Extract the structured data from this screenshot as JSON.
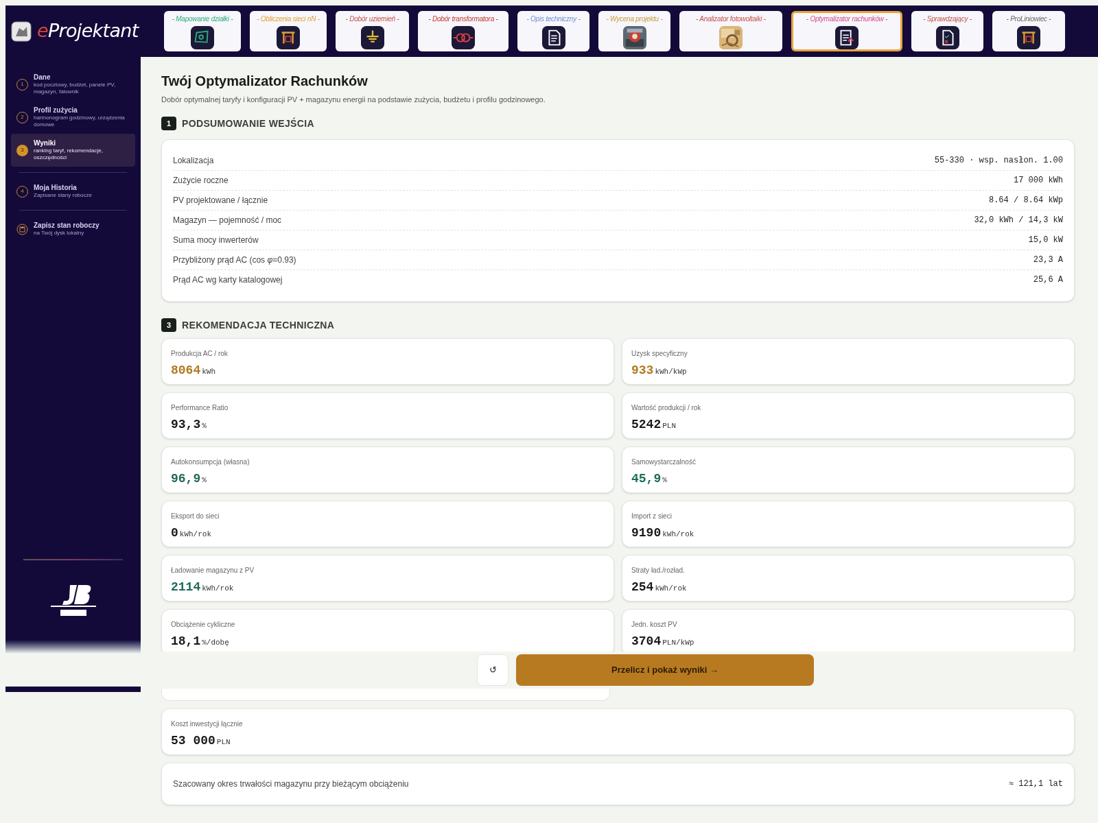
{
  "app": {
    "logo": "eProjektant"
  },
  "modules": [
    {
      "label": "- Mapowanie działki -",
      "color": "#2eaa7a",
      "selected": false
    },
    {
      "label": "- Obliczenia sieci nN -",
      "color": "#e0a030",
      "selected": false
    },
    {
      "label": "- Dobór uziemień -",
      "color": "#c0504a",
      "selected": false
    },
    {
      "label": "- Dobór transformatora -",
      "color": "#c0392b",
      "selected": false
    },
    {
      "label": "- Opis techniczny -",
      "color": "#6b8fd0",
      "selected": false
    },
    {
      "label": "- Wycena projektu -",
      "color": "#c89a3a",
      "selected": false
    },
    {
      "label": "- Analizator fotowoltaiki -",
      "color": "#c0504a",
      "selected": false
    },
    {
      "label": "- Optymalizator rachunków -",
      "color": "#d04a8a",
      "selected": true
    },
    {
      "label": "- Sprawdzający -",
      "color": "#c0504a",
      "selected": false
    },
    {
      "label": "- ProLiniowiec -",
      "color": "#666666",
      "selected": false
    }
  ],
  "sidebar": {
    "items": [
      {
        "kind": "step",
        "number": "1",
        "title": "Dane",
        "subtitle": "kod pocztowy, budżet, panele PV, magazyn, falownik",
        "selected": false
      },
      {
        "kind": "step",
        "number": "2",
        "title": "Profil zużycia",
        "subtitle": "harmonogram godzinowy, urządzenia domowe",
        "selected": false
      },
      {
        "kind": "step",
        "number": "3",
        "title": "Wyniki",
        "subtitle": "ranking taryf, rekomendacje, oszczędności",
        "selected": true
      },
      {
        "kind": "step",
        "number": "4",
        "title": "Moja Historia",
        "subtitle": "Zapisane stany robocze",
        "selected": false
      },
      {
        "kind": "action",
        "title": "Zapisz stan roboczy",
        "subtitle": "na Twój dysk lokalny",
        "selected": false
      }
    ]
  },
  "page": {
    "title": "Twój Optymalizator Rachunków",
    "subtitle": "Dobór optymalnej taryfy i konfiguracji PV + magazynu energii na podstawie zużycia, budżetu i profilu godzinowego."
  },
  "summary": {
    "number": "1",
    "heading": "PODSUMOWANIE WEJŚCIA",
    "rows": [
      {
        "label": "Lokalizacja",
        "value": "55-330 · wsp. nasłon. 1.00"
      },
      {
        "label": "Zużycie roczne",
        "value": "17 000 kWh"
      },
      {
        "label": "PV projektowane / łącznie",
        "value": "8.64 / 8.64 kWp"
      },
      {
        "label": "Magazyn — pojemność / moc",
        "value": "32,0 kWh / 14,3 kW"
      },
      {
        "label": "Suma mocy inwerterów",
        "value": "15,0 kW"
      },
      {
        "label": "Przybliżony prąd AC (cos *φ*=0.93)",
        "value": "23,3 A"
      },
      {
        "label": "Prąd AC wg karty katalogowej",
        "value": "25,6 A"
      }
    ]
  },
  "recommendation": {
    "number": "3",
    "heading": "REKOMENDACJA TECHNICZNA",
    "cards": [
      {
        "label": "Produkcja AC / rok",
        "value": "8064",
        "unit": "kWh",
        "color": "#b07a1e"
      },
      {
        "label": "Uzysk specyficzny",
        "value": "933",
        "unit": "kWh/kWp",
        "color": "#b07a1e"
      },
      {
        "label": "Performance Ratio",
        "value": "93,3",
        "unit": "%",
        "color": "#1a1a1a"
      },
      {
        "label": "Wartość produkcji / rok",
        "value": "5242",
        "unit": "PLN",
        "color": "#1a1a1a"
      },
      {
        "label": "Autokonsumpcja (własna)",
        "value": "96,9",
        "unit": "%",
        "color": "#1f6b5a"
      },
      {
        "label": "Samowystarczalność",
        "value": "45,9",
        "unit": "%",
        "color": "#1f6b5a"
      },
      {
        "label": "Eksport do sieci",
        "value": "0",
        "unit": "kWh/rok",
        "color": "#1a1a1a"
      },
      {
        "label": "Import z sieci",
        "value": "9190",
        "unit": "kWh/rok",
        "color": "#1a1a1a"
      },
      {
        "label": "Ładowanie magazynu z PV",
        "value": "2114",
        "unit": "kWh/rok",
        "color": "#1f6b5a"
      },
      {
        "label": "Straty ład./rozład.",
        "value": "254",
        "unit": "kWh/rok",
        "color": "#1a1a1a"
      },
      {
        "label": "Obciążenie cykliczne",
        "value": "18,1",
        "unit": "%/dobę",
        "color": "#1a1a1a"
      },
      {
        "label": "Jedn. koszt PV",
        "value": "3704",
        "unit": "PLN/kWp",
        "color": "#1a1a1a"
      }
    ],
    "total": {
      "label": "Koszt inwestycji łącznie",
      "value": "53 000",
      "unit": "PLN",
      "color": "#1a1a1a"
    },
    "lifetime": {
      "label": "Szacowany okres trwałości magazynu przy bieżącym obciążeniu",
      "value": "≈ 121,1 lat"
    }
  },
  "actions": {
    "reset": "↺",
    "submit": "Przelicz i pokaż wyniki →"
  }
}
